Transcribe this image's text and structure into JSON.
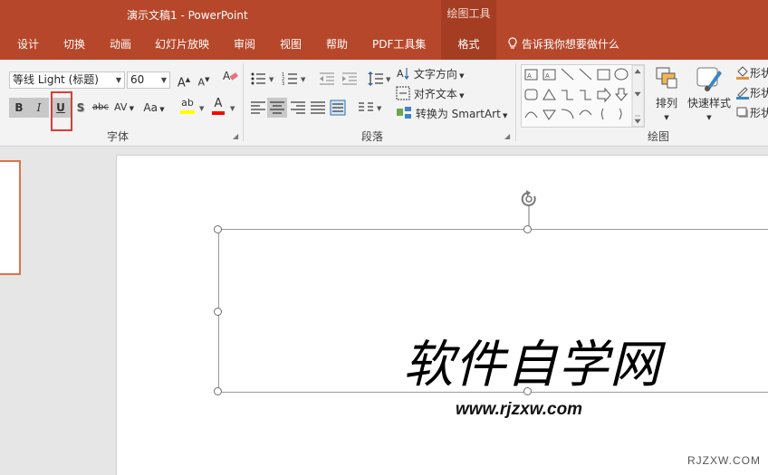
{
  "app": {
    "title": "演示文稿1  -  PowerPoint",
    "context_tab": "绘图工具"
  },
  "tabs": [
    {
      "label": "设计"
    },
    {
      "label": "切换"
    },
    {
      "label": "动画"
    },
    {
      "label": "幻灯片放映"
    },
    {
      "label": "审阅"
    },
    {
      "label": "视图"
    },
    {
      "label": "帮助"
    },
    {
      "label": "PDF工具集"
    },
    {
      "label": "格式",
      "active": true
    }
  ],
  "tell_me": "告诉我你想要做什么",
  "font_group": {
    "label": "字体",
    "font_name": "等线 Light (标题)",
    "font_size": "60",
    "grow": "A",
    "shrink": "A",
    "bold": "B",
    "italic": "I",
    "underline": "U",
    "shadow": "S",
    "strike": "abc",
    "spacing": "AV",
    "case": "Aa",
    "highlight": "ab",
    "font_color": "A"
  },
  "paragraph_group": {
    "label": "段落",
    "text_direction": "文字方向",
    "align_text": "对齐文本",
    "smartart": "转换为 SmartArt"
  },
  "drawing_group": {
    "label": "绘图",
    "arrange": "排列",
    "quick_styles": "快速样式",
    "shape_fill": "形状",
    "shape_outline": "形状",
    "shape_effects": "形状"
  },
  "slide": {
    "title_text": "软件自学网",
    "url_text": "www.rjzxw.com"
  },
  "watermark": "RJZXW.COM",
  "colors": {
    "accent": "#b7472a",
    "highlight": "#ffff00",
    "font_color": "#ff0000",
    "annotation": "#e03c31"
  }
}
